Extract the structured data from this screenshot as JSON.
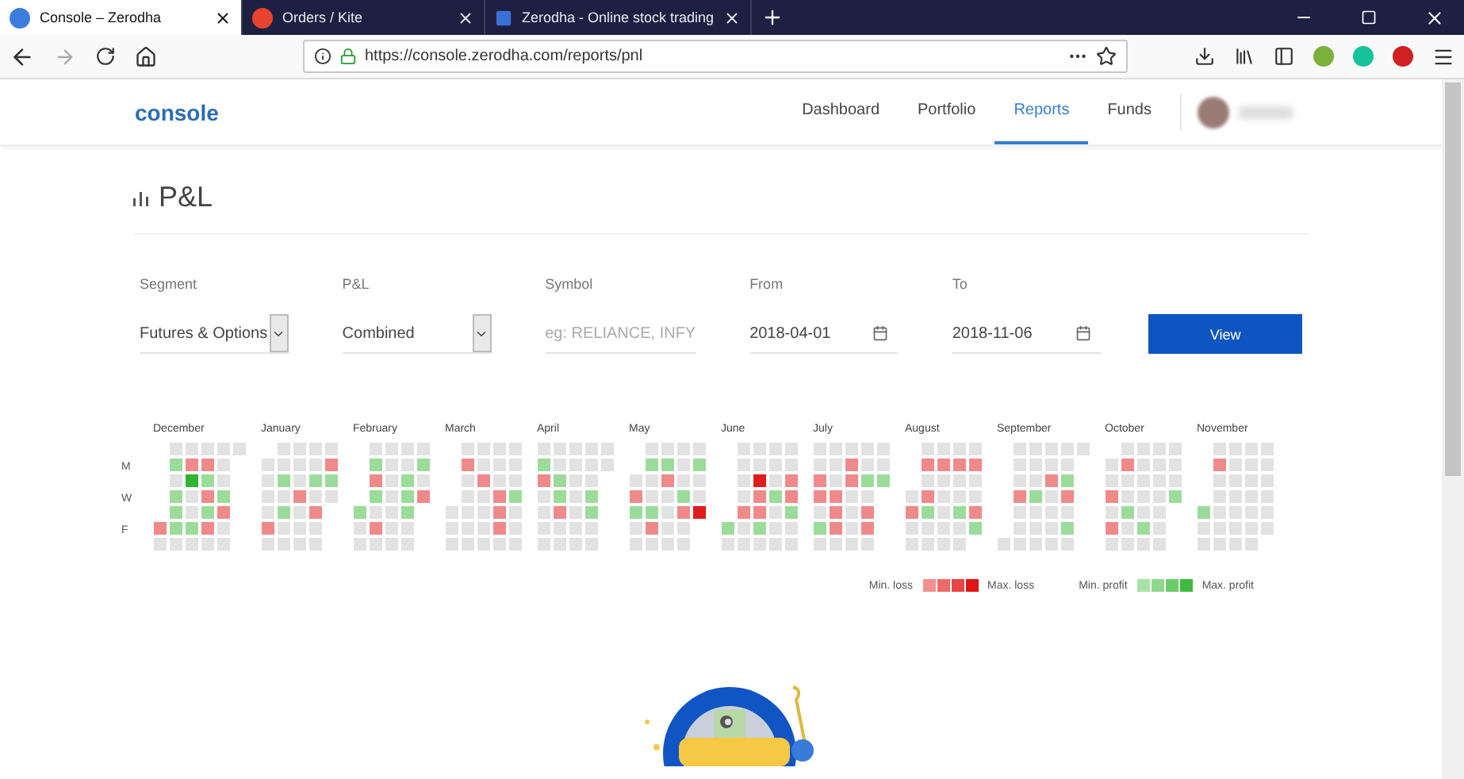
{
  "browser": {
    "tabs": [
      {
        "title": "Console – Zerodha",
        "selected": true
      },
      {
        "title": "Orders / Kite",
        "selected": false
      },
      {
        "title": "Zerodha - Online stock trading",
        "selected": false
      }
    ],
    "url": "https://console.zerodha.com/reports/pnl"
  },
  "nav": {
    "logo": "console",
    "links": [
      {
        "label": "Dashboard",
        "selected": false
      },
      {
        "label": "Portfolio",
        "selected": false
      },
      {
        "label": "Reports",
        "selected": true
      },
      {
        "label": "Funds",
        "selected": false
      }
    ]
  },
  "page": {
    "title": "P&L",
    "filters": [
      {
        "kind": "select",
        "label": "Segment",
        "value": "Futures & Options"
      },
      {
        "kind": "select",
        "label": "P&L",
        "value": "Combined"
      },
      {
        "kind": "text",
        "label": "Symbol",
        "placeholder": "eg: RELIANCE, INFY"
      },
      {
        "kind": "date",
        "label": "From",
        "value": "2018-04-01"
      },
      {
        "kind": "date",
        "label": "To",
        "value": "2018-11-06"
      }
    ],
    "view_button": "View"
  },
  "heatmap": {
    "day_labels": [
      "M",
      "W",
      "F"
    ],
    "months": [
      {
        "label": "December",
        "weeks": [
          [
            {
              "kind": "loss"
            },
            {
              "kind": "none"
            }
          ],
          [
            {
              "kind": "none"
            },
            {
              "kind": "profit"
            },
            {
              "kind": "none"
            },
            {
              "kind": "profit"
            },
            {
              "kind": "profit"
            },
            {
              "kind": "profit"
            },
            {
              "kind": "none"
            }
          ],
          [
            {
              "kind": "none"
            },
            {
              "kind": "loss"
            },
            {
              "kind": "max_profit"
            },
            {
              "kind": "none"
            },
            {
              "kind": "none"
            },
            {
              "kind": "profit"
            },
            {
              "kind": "none"
            }
          ],
          [
            {
              "kind": "none"
            },
            {
              "kind": "loss"
            },
            {
              "kind": "profit"
            },
            {
              "kind": "loss"
            },
            {
              "kind": "profit"
            },
            {
              "kind": "loss"
            },
            {
              "kind": "none"
            }
          ],
          [
            {
              "kind": "none"
            },
            {
              "kind": "none"
            },
            {
              "kind": "none"
            },
            {
              "kind": "profit"
            },
            {
              "kind": "loss"
            },
            {
              "kind": "none"
            },
            {
              "kind": "none"
            }
          ],
          [
            {
              "kind": "none"
            }
          ]
        ]
      },
      {
        "label": "January",
        "weeks": [
          [
            {
              "kind": "none"
            },
            {
              "kind": "none"
            },
            {
              "kind": "none"
            },
            {
              "kind": "none"
            },
            {
              "kind": "loss"
            },
            {
              "kind": "none"
            }
          ],
          [
            {
              "kind": "none"
            },
            {
              "kind": "none"
            },
            {
              "kind": "profit"
            },
            {
              "kind": "none"
            },
            {
              "kind": "profit"
            },
            {
              "kind": "none"
            },
            {
              "kind": "none"
            }
          ],
          [
            {
              "kind": "none"
            },
            {
              "kind": "none"
            },
            {
              "kind": "none"
            },
            {
              "kind": "loss"
            },
            {
              "kind": "none"
            },
            {
              "kind": "none"
            },
            {
              "kind": "none"
            }
          ],
          [
            {
              "kind": "none"
            },
            {
              "kind": "none"
            },
            {
              "kind": "profit"
            },
            {
              "kind": "none"
            },
            {
              "kind": "loss"
            },
            {
              "kind": "none"
            },
            {
              "kind": "none"
            }
          ],
          [
            {
              "kind": "none"
            },
            {
              "kind": "loss"
            },
            {
              "kind": "profit"
            },
            {
              "kind": "none"
            }
          ]
        ]
      },
      {
        "label": "February",
        "weeks": [
          [
            {
              "kind": "profit"
            },
            {
              "kind": "none"
            },
            {
              "kind": "none"
            }
          ],
          [
            {
              "kind": "none"
            },
            {
              "kind": "profit"
            },
            {
              "kind": "loss"
            },
            {
              "kind": "profit"
            },
            {
              "kind": "none"
            },
            {
              "kind": "loss"
            },
            {
              "kind": "none"
            }
          ],
          [
            {
              "kind": "none"
            },
            {
              "kind": "none"
            },
            {
              "kind": "none"
            },
            {
              "kind": "none"
            },
            {
              "kind": "none"
            },
            {
              "kind": "none"
            },
            {
              "kind": "none"
            }
          ],
          [
            {
              "kind": "none"
            },
            {
              "kind": "none"
            },
            {
              "kind": "profit"
            },
            {
              "kind": "profit"
            },
            {
              "kind": "profit"
            },
            {
              "kind": "none"
            },
            {
              "kind": "none"
            }
          ],
          [
            {
              "kind": "none"
            },
            {
              "kind": "profit"
            },
            {
              "kind": "none"
            },
            {
              "kind": "loss"
            }
          ]
        ]
      },
      {
        "label": "March",
        "weeks": [
          [
            {
              "kind": "none"
            },
            {
              "kind": "none"
            },
            {
              "kind": "none"
            }
          ],
          [
            {
              "kind": "none"
            },
            {
              "kind": "loss"
            },
            {
              "kind": "none"
            },
            {
              "kind": "none"
            },
            {
              "kind": "none"
            },
            {
              "kind": "none"
            },
            {
              "kind": "none"
            }
          ],
          [
            {
              "kind": "none"
            },
            {
              "kind": "none"
            },
            {
              "kind": "loss"
            },
            {
              "kind": "none"
            },
            {
              "kind": "none"
            },
            {
              "kind": "none"
            },
            {
              "kind": "none"
            }
          ],
          [
            {
              "kind": "none"
            },
            {
              "kind": "none"
            },
            {
              "kind": "none"
            },
            {
              "kind": "loss"
            },
            {
              "kind": "loss"
            },
            {
              "kind": "loss"
            },
            {
              "kind": "none"
            }
          ],
          [
            {
              "kind": "none"
            },
            {
              "kind": "none"
            },
            {
              "kind": "none"
            },
            {
              "kind": "profit"
            },
            {
              "kind": "none"
            },
            {
              "kind": "none"
            },
            {
              "kind": "none"
            }
          ]
        ]
      },
      {
        "label": "April",
        "weeks": [
          [
            {
              "kind": "none"
            },
            {
              "kind": "profit"
            },
            {
              "kind": "loss"
            },
            {
              "kind": "none"
            },
            {
              "kind": "none"
            },
            {
              "kind": "none"
            },
            {
              "kind": "none"
            }
          ],
          [
            {
              "kind": "none"
            },
            {
              "kind": "none"
            },
            {
              "kind": "profit"
            },
            {
              "kind": "profit"
            },
            {
              "kind": "loss"
            },
            {
              "kind": "none"
            },
            {
              "kind": "none"
            }
          ],
          [
            {
              "kind": "none"
            },
            {
              "kind": "none"
            },
            {
              "kind": "none"
            },
            {
              "kind": "none"
            },
            {
              "kind": "none"
            },
            {
              "kind": "none"
            },
            {
              "kind": "none"
            }
          ],
          [
            {
              "kind": "none"
            },
            {
              "kind": "none"
            },
            {
              "kind": "none"
            },
            {
              "kind": "profit"
            },
            {
              "kind": "profit"
            },
            {
              "kind": "none"
            },
            {
              "kind": "none"
            }
          ],
          [
            {
              "kind": "none"
            },
            {
              "kind": "none"
            }
          ]
        ]
      },
      {
        "label": "May",
        "weeks": [
          [
            {
              "kind": "none"
            },
            {
              "kind": "loss"
            },
            {
              "kind": "profit"
            },
            {
              "kind": "none"
            },
            {
              "kind": "none"
            }
          ],
          [
            {
              "kind": "none"
            },
            {
              "kind": "profit"
            },
            {
              "kind": "none"
            },
            {
              "kind": "none"
            },
            {
              "kind": "profit"
            },
            {
              "kind": "loss"
            },
            {
              "kind": "none"
            }
          ],
          [
            {
              "kind": "none"
            },
            {
              "kind": "profit"
            },
            {
              "kind": "loss"
            },
            {
              "kind": "none"
            },
            {
              "kind": "none"
            },
            {
              "kind": "none"
            },
            {
              "kind": "none"
            }
          ],
          [
            {
              "kind": "none"
            },
            {
              "kind": "none"
            },
            {
              "kind": "none"
            },
            {
              "kind": "profit"
            },
            {
              "kind": "loss"
            },
            {
              "kind": "none"
            },
            {
              "kind": "none"
            }
          ],
          [
            {
              "kind": "none"
            },
            {
              "kind": "profit"
            },
            {
              "kind": "none"
            },
            {
              "kind": "none"
            },
            {
              "kind": "max_loss"
            }
          ]
        ]
      },
      {
        "label": "June",
        "weeks": [
          [
            {
              "kind": "profit"
            },
            {
              "kind": "none"
            }
          ],
          [
            {
              "kind": "none"
            },
            {
              "kind": "none"
            },
            {
              "kind": "none"
            },
            {
              "kind": "none"
            },
            {
              "kind": "loss"
            },
            {
              "kind": "none"
            },
            {
              "kind": "none"
            }
          ],
          [
            {
              "kind": "none"
            },
            {
              "kind": "none"
            },
            {
              "kind": "max_loss"
            },
            {
              "kind": "loss"
            },
            {
              "kind": "loss"
            },
            {
              "kind": "profit"
            },
            {
              "kind": "none"
            }
          ],
          [
            {
              "kind": "none"
            },
            {
              "kind": "none"
            },
            {
              "kind": "none"
            },
            {
              "kind": "profit"
            },
            {
              "kind": "none"
            },
            {
              "kind": "none"
            },
            {
              "kind": "none"
            }
          ],
          [
            {
              "kind": "none"
            },
            {
              "kind": "none"
            },
            {
              "kind": "loss"
            },
            {
              "kind": "loss"
            },
            {
              "kind": "profit"
            },
            {
              "kind": "none"
            },
            {
              "kind": "none"
            }
          ]
        ]
      },
      {
        "label": "July",
        "weeks": [
          [
            {
              "kind": "none"
            },
            {
              "kind": "none"
            },
            {
              "kind": "loss"
            },
            {
              "kind": "loss"
            },
            {
              "kind": "none"
            },
            {
              "kind": "profit"
            },
            {
              "kind": "none"
            }
          ],
          [
            {
              "kind": "none"
            },
            {
              "kind": "none"
            },
            {
              "kind": "none"
            },
            {
              "kind": "loss"
            },
            {
              "kind": "loss"
            },
            {
              "kind": "loss"
            },
            {
              "kind": "none"
            }
          ],
          [
            {
              "kind": "none"
            },
            {
              "kind": "loss"
            },
            {
              "kind": "loss"
            },
            {
              "kind": "none"
            },
            {
              "kind": "none"
            },
            {
              "kind": "none"
            },
            {
              "kind": "none"
            }
          ],
          [
            {
              "kind": "none"
            },
            {
              "kind": "none"
            },
            {
              "kind": "profit"
            },
            {
              "kind": "none"
            },
            {
              "kind": "loss"
            },
            {
              "kind": "loss"
            },
            {
              "kind": "none"
            }
          ],
          [
            {
              "kind": "none"
            },
            {
              "kind": "none"
            },
            {
              "kind": "profit"
            }
          ]
        ]
      },
      {
        "label": "August",
        "weeks": [
          [
            {
              "kind": "none"
            },
            {
              "kind": "loss"
            },
            {
              "kind": "none"
            },
            {
              "kind": "none"
            }
          ],
          [
            {
              "kind": "none"
            },
            {
              "kind": "loss"
            },
            {
              "kind": "none"
            },
            {
              "kind": "loss"
            },
            {
              "kind": "profit"
            },
            {
              "kind": "none"
            },
            {
              "kind": "none"
            }
          ],
          [
            {
              "kind": "none"
            },
            {
              "kind": "loss"
            },
            {
              "kind": "none"
            },
            {
              "kind": "none"
            },
            {
              "kind": "none"
            },
            {
              "kind": "none"
            },
            {
              "kind": "none"
            }
          ],
          [
            {
              "kind": "none"
            },
            {
              "kind": "loss"
            },
            {
              "kind": "none"
            },
            {
              "kind": "none"
            },
            {
              "kind": "profit"
            },
            {
              "kind": "none"
            },
            {
              "kind": "none"
            }
          ],
          [
            {
              "kind": "none"
            },
            {
              "kind": "loss"
            },
            {
              "kind": "none"
            },
            {
              "kind": "none"
            },
            {
              "kind": "loss"
            },
            {
              "kind": "profit"
            }
          ]
        ]
      },
      {
        "label": "September",
        "weeks": [
          [
            {
              "kind": "none"
            }
          ],
          [
            {
              "kind": "none"
            },
            {
              "kind": "none"
            },
            {
              "kind": "none"
            },
            {
              "kind": "loss"
            },
            {
              "kind": "none"
            },
            {
              "kind": "none"
            },
            {
              "kind": "none"
            }
          ],
          [
            {
              "kind": "none"
            },
            {
              "kind": "none"
            },
            {
              "kind": "none"
            },
            {
              "kind": "profit"
            },
            {
              "kind": "none"
            },
            {
              "kind": "none"
            },
            {
              "kind": "none"
            }
          ],
          [
            {
              "kind": "none"
            },
            {
              "kind": "none"
            },
            {
              "kind": "loss"
            },
            {
              "kind": "none"
            },
            {
              "kind": "none"
            },
            {
              "kind": "none"
            },
            {
              "kind": "none"
            }
          ],
          [
            {
              "kind": "none"
            },
            {
              "kind": "none"
            },
            {
              "kind": "profit"
            },
            {
              "kind": "loss"
            },
            {
              "kind": "none"
            },
            {
              "kind": "profit"
            },
            {
              "kind": "none"
            }
          ],
          [
            {
              "kind": "none"
            }
          ]
        ]
      },
      {
        "label": "October",
        "weeks": [
          [
            {
              "kind": "none"
            },
            {
              "kind": "none"
            },
            {
              "kind": "loss"
            },
            {
              "kind": "none"
            },
            {
              "kind": "loss"
            },
            {
              "kind": "none"
            }
          ],
          [
            {
              "kind": "none"
            },
            {
              "kind": "loss"
            },
            {
              "kind": "none"
            },
            {
              "kind": "none"
            },
            {
              "kind": "profit"
            },
            {
              "kind": "none"
            },
            {
              "kind": "none"
            }
          ],
          [
            {
              "kind": "none"
            },
            {
              "kind": "none"
            },
            {
              "kind": "none"
            },
            {
              "kind": "none"
            },
            {
              "kind": "none"
            },
            {
              "kind": "profit"
            },
            {
              "kind": "none"
            }
          ],
          [
            {
              "kind": "none"
            },
            {
              "kind": "none"
            },
            {
              "kind": "none"
            },
            {
              "kind": "none"
            },
            {
              "kind": "none"
            },
            {
              "kind": "none"
            },
            {
              "kind": "none"
            }
          ],
          [
            {
              "kind": "none"
            },
            {
              "kind": "none"
            },
            {
              "kind": "none"
            },
            {
              "kind": "profit"
            }
          ]
        ]
      },
      {
        "label": "November",
        "weeks": [
          [
            {
              "kind": "profit"
            },
            {
              "kind": "none"
            },
            {
              "kind": "none"
            }
          ],
          [
            {
              "kind": "none"
            },
            {
              "kind": "loss"
            },
            {
              "kind": "none"
            },
            {
              "kind": "none"
            },
            {
              "kind": "none"
            },
            {
              "kind": "none"
            },
            {
              "kind": "none"
            }
          ],
          [
            {
              "kind": "none"
            },
            {
              "kind": "none"
            },
            {
              "kind": "none"
            },
            {
              "kind": "none"
            },
            {
              "kind": "none"
            },
            {
              "kind": "none"
            },
            {
              "kind": "none"
            }
          ],
          [
            {
              "kind": "none"
            },
            {
              "kind": "none"
            },
            {
              "kind": "none"
            },
            {
              "kind": "none"
            },
            {
              "kind": "none"
            },
            {
              "kind": "none"
            },
            {
              "kind": "none"
            }
          ],
          [
            {
              "kind": "none"
            },
            {
              "kind": "none"
            },
            {
              "kind": "none"
            },
            {
              "kind": "none"
            },
            {
              "kind": "none"
            },
            {
              "kind": "none"
            }
          ]
        ]
      }
    ],
    "legend": {
      "loss_min": "Min. loss",
      "loss_max": "Max. loss",
      "profit_min": "Min. profit",
      "profit_max": "Max. profit"
    }
  }
}
